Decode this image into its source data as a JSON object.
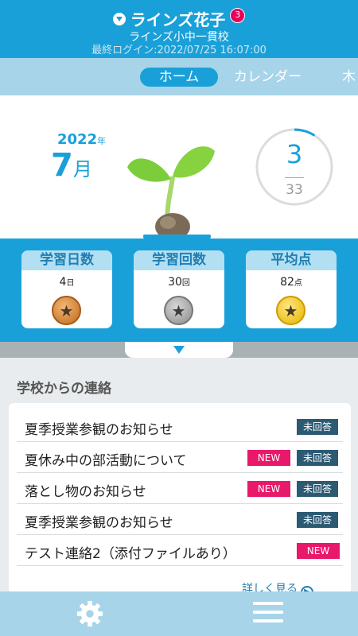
{
  "header": {
    "user_name": "ラインズ花子",
    "notification_count": "3",
    "school": "ラインズ小中一貫校",
    "last_login": "最終ログイン:2022/07/25 16:07:00"
  },
  "tabs": [
    {
      "label": "ホーム",
      "active": true
    },
    {
      "label": "カレンダー",
      "active": false
    },
    {
      "label": "木",
      "active": false
    }
  ],
  "hero": {
    "year": "2022",
    "year_unit": "年",
    "month": "7",
    "month_unit": "月",
    "progress_current": "3",
    "progress_total": "33",
    "progress_fraction": 0.0909
  },
  "stats": [
    {
      "label": "学習日数",
      "value": "4",
      "unit": "日",
      "medal": "bronze"
    },
    {
      "label": "学習回数",
      "value": "30",
      "unit": "回",
      "medal": "silver"
    },
    {
      "label": "平均点",
      "value": "82",
      "unit": "点",
      "medal": "gold"
    }
  ],
  "notices": {
    "title": "学校からの連絡",
    "items": [
      {
        "text": "夏季授業参観のお知らせ",
        "new": false,
        "unanswered": true
      },
      {
        "text": "夏休み中の部活動について",
        "new": true,
        "unanswered": true
      },
      {
        "text": "落とし物のお知らせ",
        "new": true,
        "unanswered": true
      },
      {
        "text": "夏季授業参観のお知らせ",
        "new": false,
        "unanswered": true
      },
      {
        "text": "テスト連絡2（添付ファイルあり）",
        "new": true,
        "unanswered": false
      }
    ],
    "new_label": "NEW",
    "unanswered_label": "未回答",
    "more_label": "詳しく見る"
  },
  "colors": {
    "primary": "#1aa0d9",
    "light": "#a7d4e8",
    "new_tag": "#e8186a",
    "unanswered_tag": "#2c5a73"
  },
  "icons": {
    "settings": "gear-icon",
    "menu": "hamburger-menu-icon"
  }
}
